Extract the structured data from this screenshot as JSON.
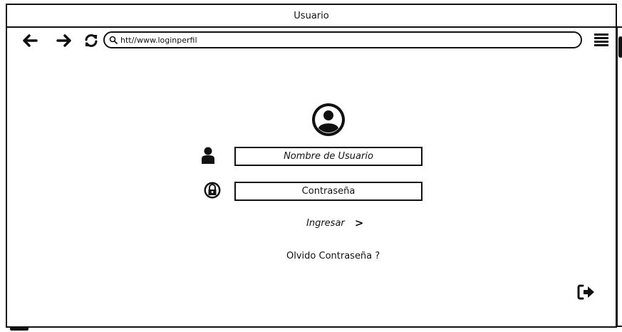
{
  "window": {
    "title": "Usuario"
  },
  "browser": {
    "url": "htt//www.loginperfil",
    "icons": [
      "back-arrow-icon",
      "forward-arrow-icon",
      "refresh-icon",
      "search-icon",
      "hamburger-menu-icon"
    ]
  },
  "login": {
    "username_placeholder": "Nombre de Usuario",
    "password_placeholder": "Contraseña",
    "submit_label": "Ingresar",
    "submit_icon": ">",
    "forgot_label": "Olvido Contraseña ?"
  },
  "icons": {
    "avatar": "user-circle-icon",
    "username": "user-icon",
    "password": "lock-icon",
    "logout": "sign-out-icon"
  }
}
